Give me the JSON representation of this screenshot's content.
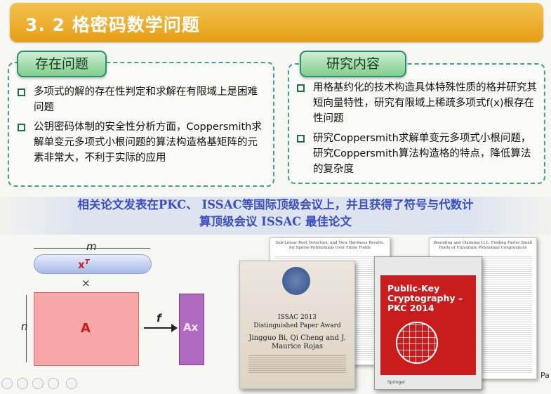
{
  "slide": {
    "title": "3. 2  格密码数学问题",
    "page_marker": "Pa"
  },
  "left_panel": {
    "tag": "存在问题",
    "bullets": [
      "多项式的解的存在性判定和求解在有限域上是困难问题",
      "公钥密码体制的安全性分析方面，Coppersmith求解单变元多项式小根问题的算法构造格基矩阵的元素非常大，不利于实际的应用"
    ]
  },
  "right_panel": {
    "tag": "研究内容",
    "bullets": [
      "用格基约化的技术构造具体特殊性质的格并研究其短向量特性，研究有限域上稀疏多项式f(x)根存在性问题",
      "研究Coppersmith求解单变元多项式小根问题，研究Coppersmith算法构造格的特点，降低算法的复杂度"
    ]
  },
  "highlight": {
    "line1": "相关论文发表在PKC、 ISSAC等国际顶级会议上，并且获得了符号与代数计",
    "line2": "算顶级会议 ISSAC 最佳论文"
  },
  "diagram": {
    "m_label": "m",
    "x_label": "x",
    "x_sup": "T",
    "times": "×",
    "n_label": "n",
    "A_label": "A",
    "f_label": "f",
    "Ax_label": "Ax"
  },
  "images": {
    "paper1_title": "Sub-Linear Root Detection, and New Hardness Results, for Sparse Polynomials Over Finite Fields",
    "paper2_title": "Bounding and Claiming LLL: Finding Faster Small Roots of Univariate Polynomial Congruences",
    "award_line1": "ISSAC 2013",
    "award_line2": "Distinguished Paper Award",
    "award_line3": "Jingguo Bi, Qi Cheng and J. Maurice Rojas",
    "book_title": "Public-Key Cryptography – PKC 2014",
    "book_publisher": "Springer"
  },
  "colors": {
    "title_bar": "#e9a11b",
    "panel_border": "#3aa38a",
    "tag_fill": "#9bd9a4",
    "highlight_text": "#3b4fbf",
    "box_A": "#f7a7a7",
    "box_Ax": "#b06ac0"
  }
}
